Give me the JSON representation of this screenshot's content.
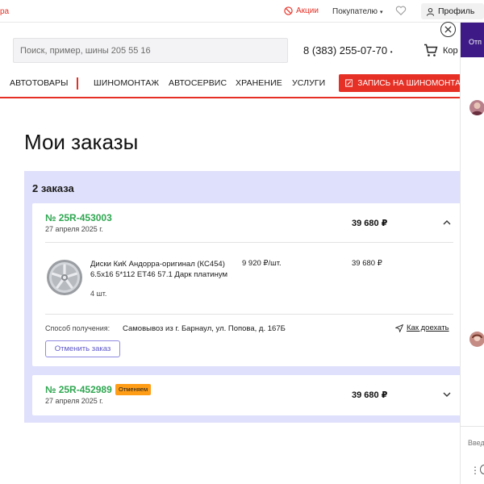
{
  "topbar": {
    "left_cut_text": "ра",
    "promo_label": "Акции",
    "buyer_label": "Покупателю",
    "profile_label": "Профиль"
  },
  "header": {
    "search_placeholder": "Поиск, пример, шины 205 55 16",
    "phone": "8 (383) 255-07-70",
    "cart_label": "Кор"
  },
  "nav": {
    "items": [
      "АВТОТОВАРЫ",
      "ШИНОМОНТАЖ",
      "АВТОСЕРВИС",
      "ХРАНЕНИЕ",
      "УСЛУГИ"
    ],
    "cta_label": "ЗАПИСЬ НА ШИНОМОНТАЖ"
  },
  "page": {
    "title": "Мои заказы",
    "orders_count": "2 заказа"
  },
  "orders": [
    {
      "number": "№ 25R-453003",
      "date": "27 апреля 2025 г.",
      "total": "39 680 ₽",
      "product": {
        "name": "Диски КиК Андорра-оригинал (КС454) 6.5x16 5*112 ET46 57.1 Дарк платинум",
        "price_per_unit": "9 920 ₽/шт.",
        "total": "39 680 ₽",
        "quantity": "4 шт."
      },
      "delivery_label": "Способ получения:",
      "delivery_value": "Самовывоз из г. Барнаул, ул. Попова, д. 167Б",
      "route_label": "Как доехать",
      "cancel_label": "Отменить заказ"
    },
    {
      "number": "№ 25R-452989",
      "status_badge": "Отменяем",
      "date": "27 апреля 2025 г.",
      "total": "39 680 ₽"
    }
  ],
  "chat": {
    "header_cut": "Отп",
    "input_placeholder_cut": "Введ"
  },
  "colors": {
    "brand_red": "#e63026",
    "order_green": "#2fa651",
    "orders_bg": "#dfe0fb",
    "badge_orange": "#ff9d17",
    "cancel_purple": "#5e58c9",
    "chat_header": "#3d1a85"
  }
}
